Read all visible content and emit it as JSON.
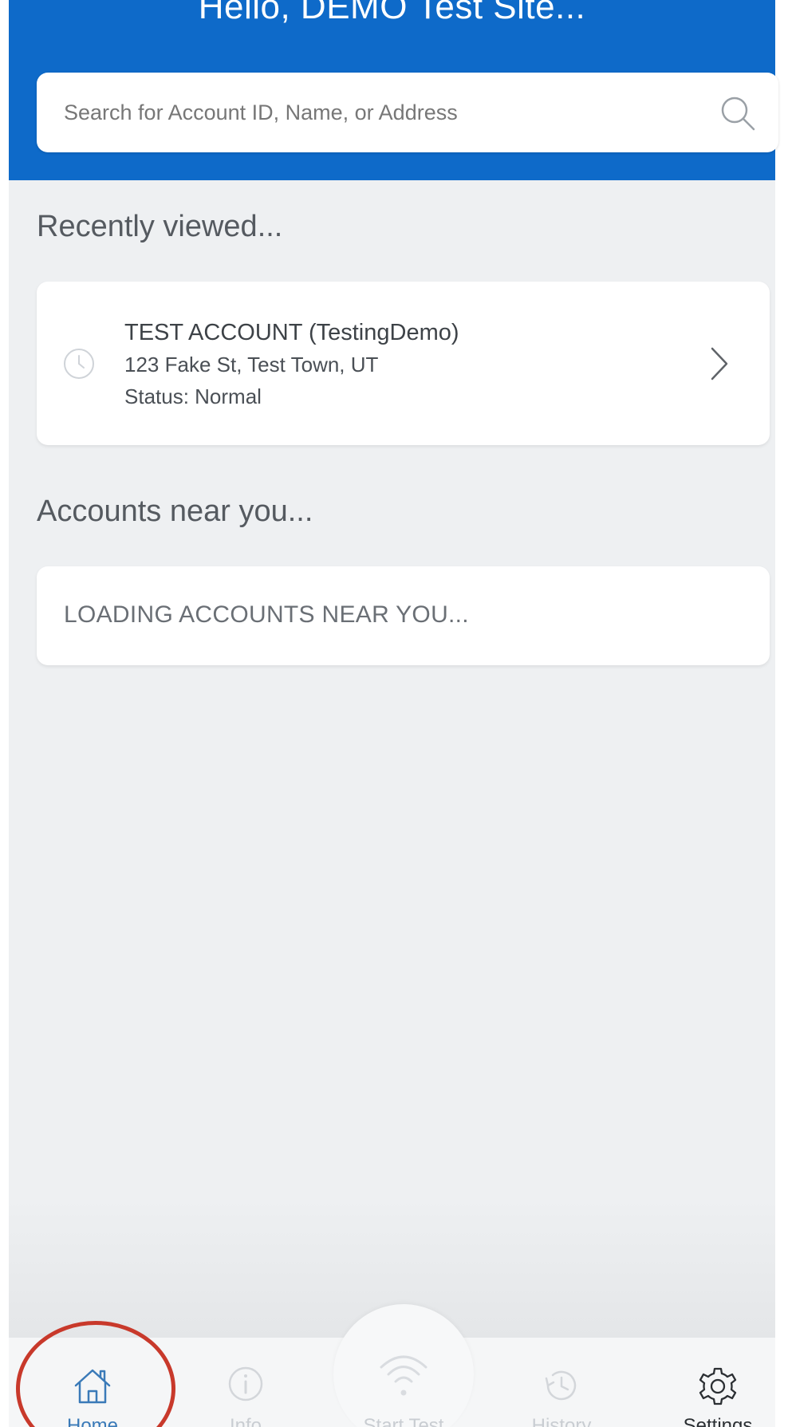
{
  "header": {
    "greeting": "Hello, DEMO Test Site..."
  },
  "search": {
    "placeholder": "Search for Account ID, Name, or Address",
    "icon": "search-icon"
  },
  "recent": {
    "title": "Recently viewed...",
    "items": [
      {
        "name": "TEST ACCOUNT (TestingDemo)",
        "address": "123 Fake St, Test Town, UT",
        "status": "Status: Normal",
        "icon": "clock-icon"
      }
    ]
  },
  "nearby": {
    "title": "Accounts near you...",
    "loading_text": "LOADING ACCOUNTS NEAR YOU..."
  },
  "tabs": [
    {
      "label": "Home",
      "icon": "home-icon",
      "active": true
    },
    {
      "label": "Info",
      "icon": "info-icon",
      "active": false
    },
    {
      "label": "Start Test",
      "icon": "wifi-icon",
      "active": false
    },
    {
      "label": "History",
      "icon": "history-icon",
      "active": false
    },
    {
      "label": "Settings",
      "icon": "gear-icon",
      "active": false
    }
  ],
  "colors": {
    "header_bg": "#0e6ac9",
    "page_bg": "#eef0f2",
    "active_tab": "#3a7ab8",
    "inactive_tab": "#c9cdd2",
    "highlight": "#c8392b"
  }
}
